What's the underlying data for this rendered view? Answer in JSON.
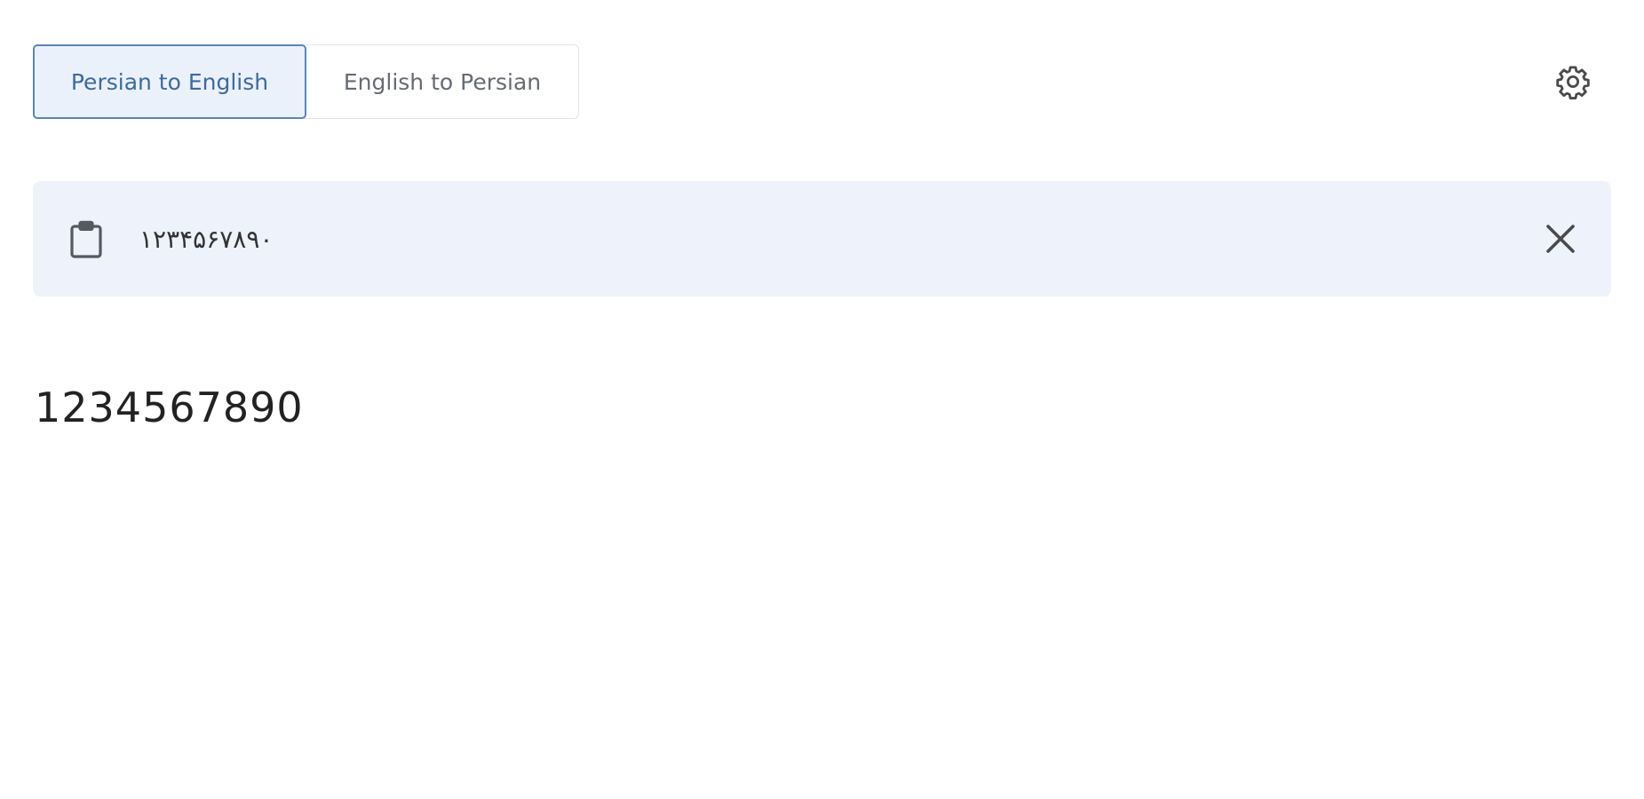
{
  "mode_toggle": {
    "persian_to_english": "Persian to English",
    "english_to_persian": "English to Persian",
    "active": "persian_to_english"
  },
  "settings": {
    "icon": "gear-icon"
  },
  "input": {
    "value": "۱۲۳۴۵۶۷۸۹۰",
    "paste_icon": "clipboard-icon",
    "clear_icon": "close-icon"
  },
  "output": {
    "value": "1234567890"
  },
  "colors": {
    "accent": "#3d6a9e",
    "accent_border": "#5b86b8",
    "active_bg": "#ebf1fa",
    "input_bg": "#eef2fb"
  }
}
